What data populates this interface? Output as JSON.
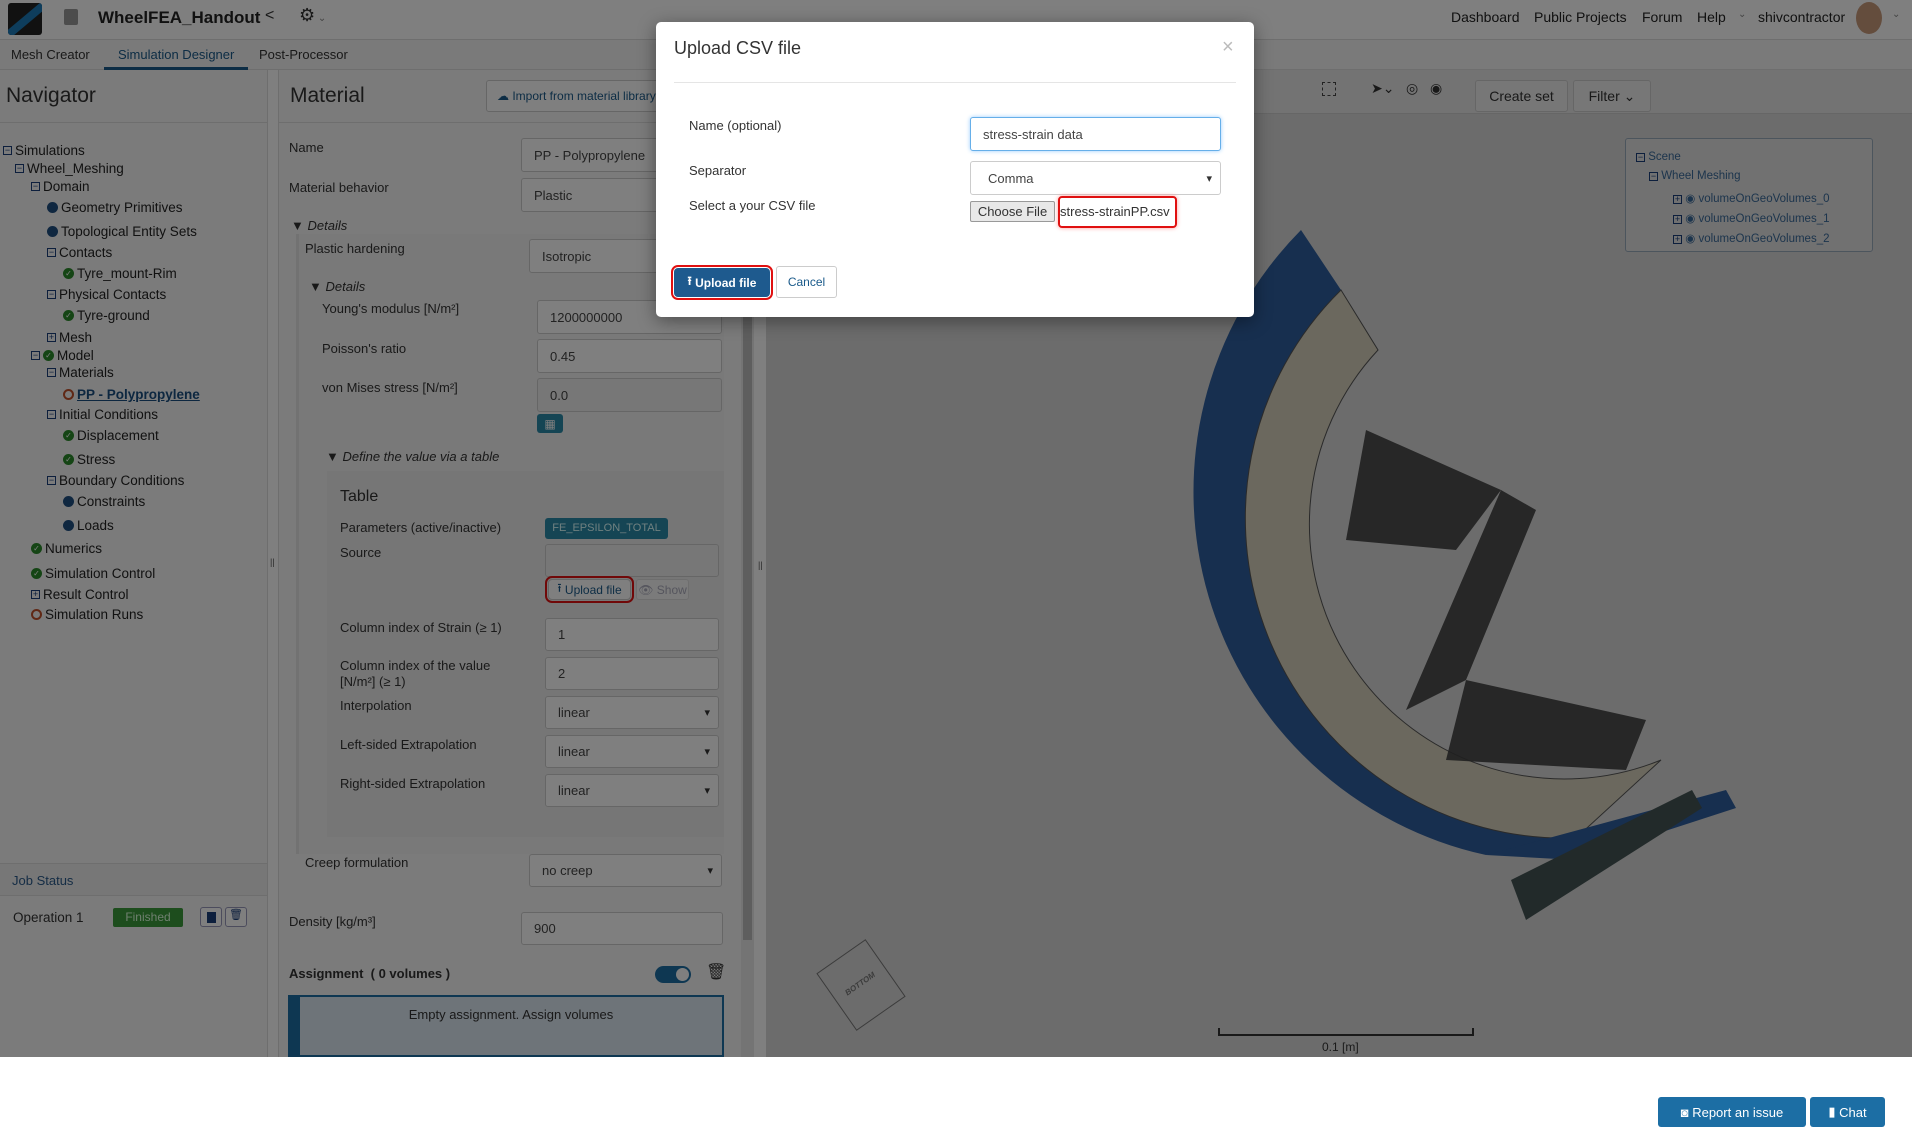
{
  "topbar": {
    "project_title": "WheelFEA_Handout",
    "links": [
      "Dashboard",
      "Public Projects",
      "Forum",
      "Help"
    ],
    "username": "shivcontractor"
  },
  "tabs": [
    "Mesh Creator",
    "Simulation Designer",
    "Post-Processor"
  ],
  "navigator": {
    "title": "Navigator",
    "items": [
      {
        "label": "Simulations",
        "depth": 0,
        "icon": "collapse"
      },
      {
        "label": "Wheel_Meshing",
        "depth": 1,
        "icon": "collapse"
      },
      {
        "label": "Domain",
        "depth": 2,
        "icon": "collapse"
      },
      {
        "label": "Geometry Primitives",
        "depth": 3,
        "icon": "dot"
      },
      {
        "label": "Topological Entity Sets",
        "depth": 3,
        "icon": "dot"
      },
      {
        "label": "Contacts",
        "depth": 3,
        "icon": "collapse"
      },
      {
        "label": "Tyre_mount-Rim",
        "depth": 4,
        "icon": "check"
      },
      {
        "label": "Physical Contacts",
        "depth": 3,
        "icon": "collapse"
      },
      {
        "label": "Tyre-ground",
        "depth": 4,
        "icon": "check"
      },
      {
        "label": "Mesh",
        "depth": 3,
        "icon": "expand"
      },
      {
        "label": "Model",
        "depth": 2,
        "icon": "collapse-check"
      },
      {
        "label": "Materials",
        "depth": 3,
        "icon": "collapse"
      },
      {
        "label": "PP - Polypropylene",
        "depth": 4,
        "icon": "ring",
        "active": true
      },
      {
        "label": "Initial Conditions",
        "depth": 3,
        "icon": "collapse"
      },
      {
        "label": "Displacement",
        "depth": 4,
        "icon": "check"
      },
      {
        "label": "Stress",
        "depth": 4,
        "icon": "check"
      },
      {
        "label": "Boundary Conditions",
        "depth": 3,
        "icon": "collapse"
      },
      {
        "label": "Constraints",
        "depth": 4,
        "icon": "dot"
      },
      {
        "label": "Loads",
        "depth": 4,
        "icon": "dot"
      },
      {
        "label": "Numerics",
        "depth": 2,
        "icon": "check"
      },
      {
        "label": "Simulation Control",
        "depth": 2,
        "icon": "check"
      },
      {
        "label": "Result Control",
        "depth": 2,
        "icon": "expand"
      },
      {
        "label": "Simulation Runs",
        "depth": 2,
        "icon": "ring"
      }
    ],
    "job_status": {
      "title": "Job Status",
      "operation": "Operation 1",
      "status": "Finished"
    }
  },
  "material": {
    "title": "Material",
    "import_button": "Import from material library",
    "name_label": "Name",
    "name_value": "PP  - Polypropylene",
    "behavior_label": "Material behavior",
    "behavior_value": "Plastic",
    "details_label": "Details",
    "hardening_label": "Plastic hardening",
    "hardening_value": "Isotropic",
    "details2_label": "Details",
    "youngs_label": "Young's modulus [N/m²]",
    "youngs_value": "1200000000",
    "poisson_label": "Poisson's ratio",
    "poisson_value": "0.45",
    "vonmises_label": "von Mises stress [N/m²]",
    "vonmises_value": "0.0",
    "define_table_label": "Define the value via a table",
    "table": {
      "title": "Table",
      "params_label": "Parameters (active/inactive)",
      "params_badge": "FE_EPSILON_TOTAL",
      "source_label": "Source",
      "source_value": "",
      "upload_button": "Upload file",
      "show_button": "Show",
      "col_strain_label": "Column index of Strain (≥ 1)",
      "col_strain_value": "1",
      "col_value_label": "Column index of the value [N/m²] (≥ 1)",
      "col_value_value": "2",
      "interp_label": "Interpolation",
      "interp_value": "linear",
      "left_label": "Left-sided Extrapolation",
      "left_value": "linear",
      "right_label": "Right-sided Extrapolation",
      "right_value": "linear"
    },
    "creep_label": "Creep formulation",
    "creep_value": "no creep",
    "density_label": "Density [kg/m³]",
    "density_value": "900",
    "assignment_label": "Assignment  ( 0 volumes )",
    "assignment_empty": "Empty assignment. Assign volumes"
  },
  "viewport": {
    "create_set": "Create set",
    "filter": "Filter",
    "scene_tree": [
      "Scene",
      "Wheel Meshing",
      "volumeOnGeoVolumes_0",
      "volumeOnGeoVolumes_1",
      "volumeOnGeoVolumes_2"
    ],
    "cube_face": "BOTTOM",
    "scale_label": "0.1 [m]",
    "report_button": "Report an issue",
    "chat_button": "Chat"
  },
  "modal": {
    "title": "Upload CSV file",
    "name_label": "Name (optional)",
    "name_value": "stress-strain data",
    "separator_label": "Separator",
    "separator_value": "Comma",
    "file_label": "Select a your CSV file",
    "choose_file": "Choose File",
    "file_name": "stress-strainPP.csv",
    "upload_button": "Upload file",
    "cancel_button": "Cancel"
  }
}
